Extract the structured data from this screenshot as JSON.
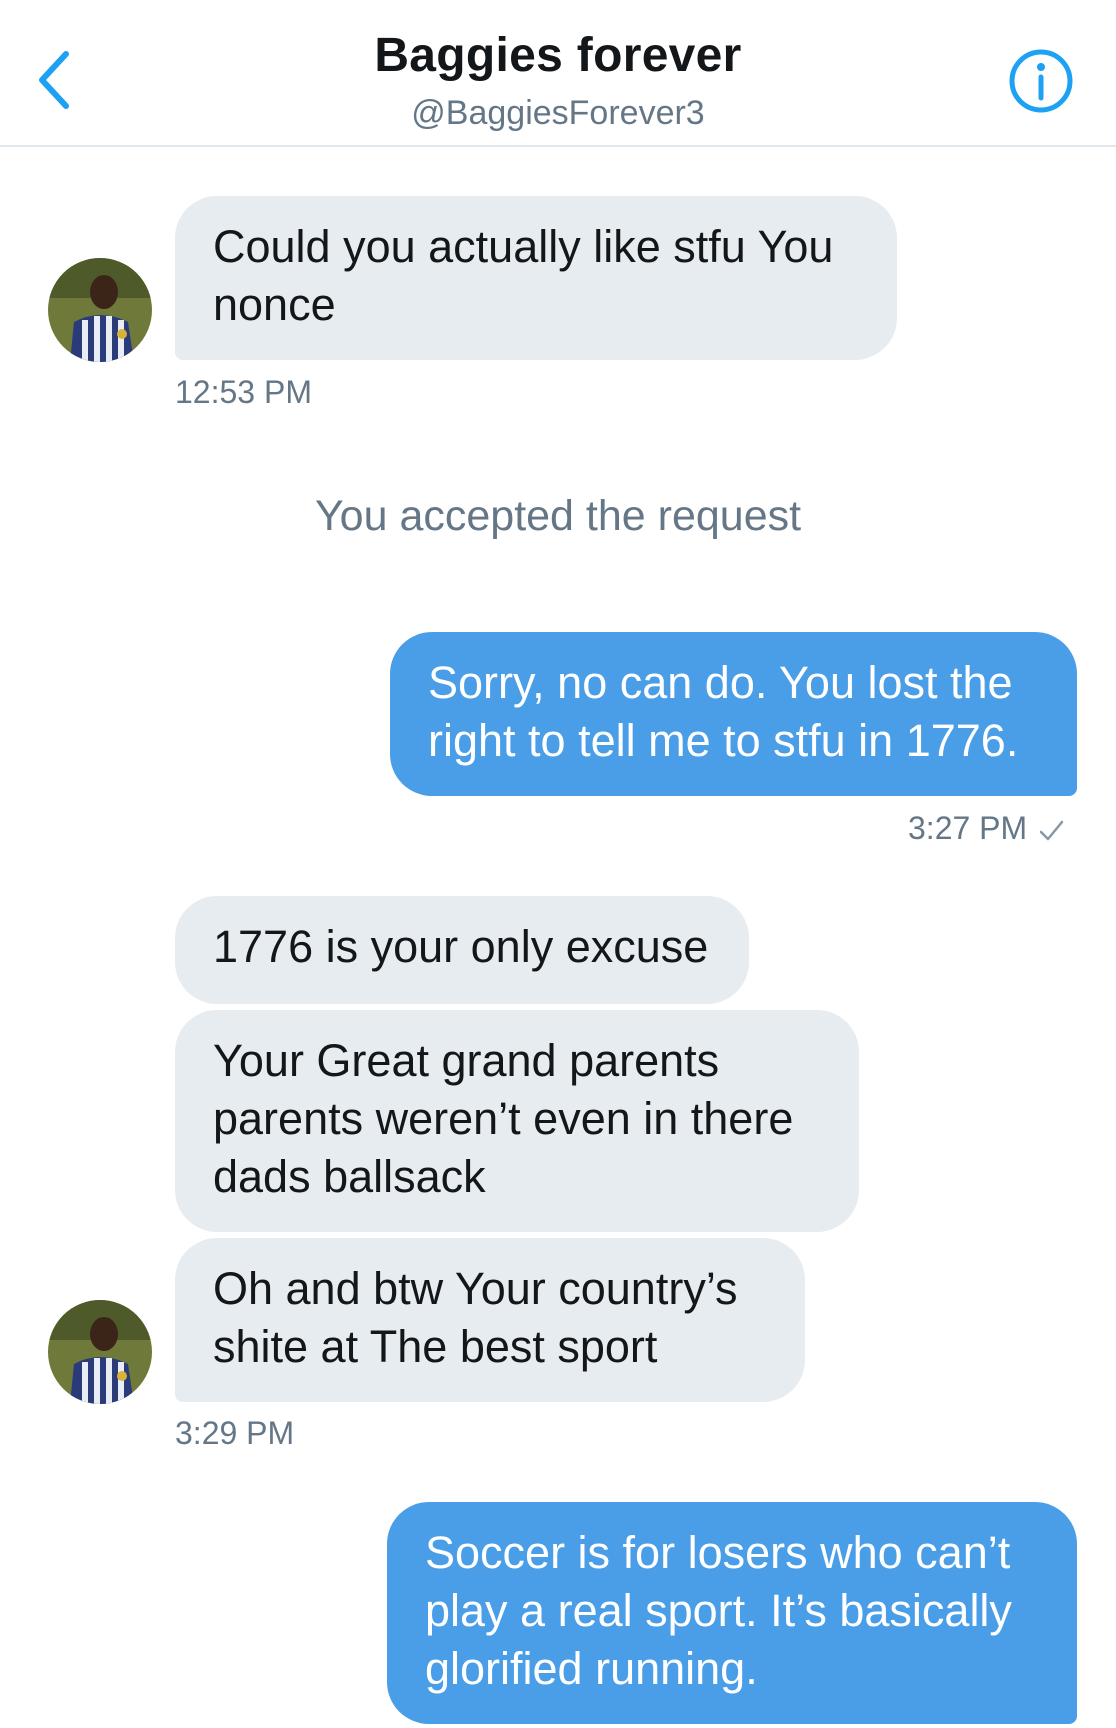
{
  "header": {
    "name": "Baggies forever",
    "handle": "@BaggiesForever3",
    "back_icon": "chevron-left-icon",
    "info_icon": "info-icon"
  },
  "colors": {
    "accent": "#1da1f2",
    "sent_bubble": "#4a9ee8",
    "received_bubble": "#e6ecf0",
    "muted_text": "#657786"
  },
  "messages": [
    {
      "from": "them",
      "text": "Could you actually like stfu You nonce",
      "time": "12:53 PM"
    },
    {
      "system": "You accepted the request"
    },
    {
      "from": "me",
      "text": "Sorry, no can do. You lost the right to tell me to stfu in 1776.",
      "time": "3:27 PM"
    },
    {
      "from": "them",
      "text": "1776 is your only excuse"
    },
    {
      "from": "them",
      "text": "Your Great grand parents parents weren’t even in there dads ballsack"
    },
    {
      "from": "them",
      "text": "Oh and btw Your country’s shite at The best sport",
      "time": "3:29 PM"
    },
    {
      "from": "me",
      "text": "Soccer is for losers who can’t play a real sport. It’s basically glorified running."
    }
  ]
}
